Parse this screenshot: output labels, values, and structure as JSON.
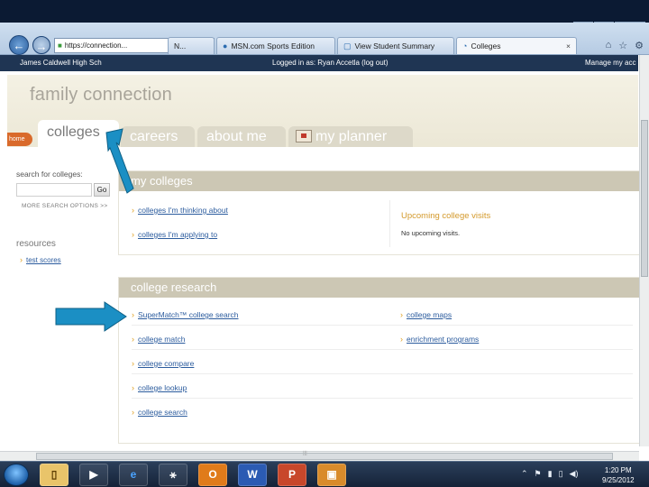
{
  "browser": {
    "window_controls": [
      "–",
      "□",
      "x"
    ],
    "address": "https://connection...",
    "address_icons": [
      "⌕",
      "🔒",
      "C"
    ],
    "tabs": [
      {
        "label": "N..."
      },
      {
        "label": "MSN.com Sports Edition"
      },
      {
        "label": "View Student Summary"
      },
      {
        "label": "Colleges",
        "close": "×"
      }
    ],
    "toolbar_icons": [
      "⌂",
      "☆",
      "⚙"
    ]
  },
  "site": {
    "school": "James Caldwell High Sch",
    "logged_in": "Logged in as: Ryan Accetla (log out)",
    "manage": "Manage my acc",
    "title": "family connection",
    "home_tab": "home",
    "tabs": [
      "colleges",
      "careers",
      "about me",
      "my planner"
    ]
  },
  "sidebar": {
    "search_label": "search for colleges:",
    "search_placeholder": "",
    "go_label": "Go",
    "more_options": "MORE SEARCH OPTIONS >>",
    "resources_title": "resources",
    "resources_links": [
      "test scores"
    ]
  },
  "my_colleges": {
    "header": "my colleges",
    "links": [
      "colleges I'm thinking about",
      "colleges I'm applying to"
    ],
    "visits_title": "Upcoming college visits",
    "visits_text": "No upcoming visits."
  },
  "college_research": {
    "header": "college research",
    "left_links": [
      "SuperMatch™ college search",
      "college match",
      "college compare",
      "college lookup",
      "college search"
    ],
    "right_links": [
      "college maps",
      "enrichment programs"
    ]
  },
  "scrollbar": {
    "h_grip": "⦙⦙⦙"
  },
  "taskbar": {
    "apps": [
      "▯",
      "▶",
      "e",
      "⚹",
      "O",
      "W",
      "P",
      "▣"
    ],
    "tray": [
      "⌃",
      "⚑",
      "▮",
      "▯",
      "◀)"
    ],
    "time": "1:20 PM",
    "date": "9/25/2012"
  },
  "colors": {
    "accent_orange": "#d96a2b",
    "arrow_blue": "#1b8fc4",
    "link_blue": "#2c5c9e",
    "chevron": "#e0a020"
  }
}
